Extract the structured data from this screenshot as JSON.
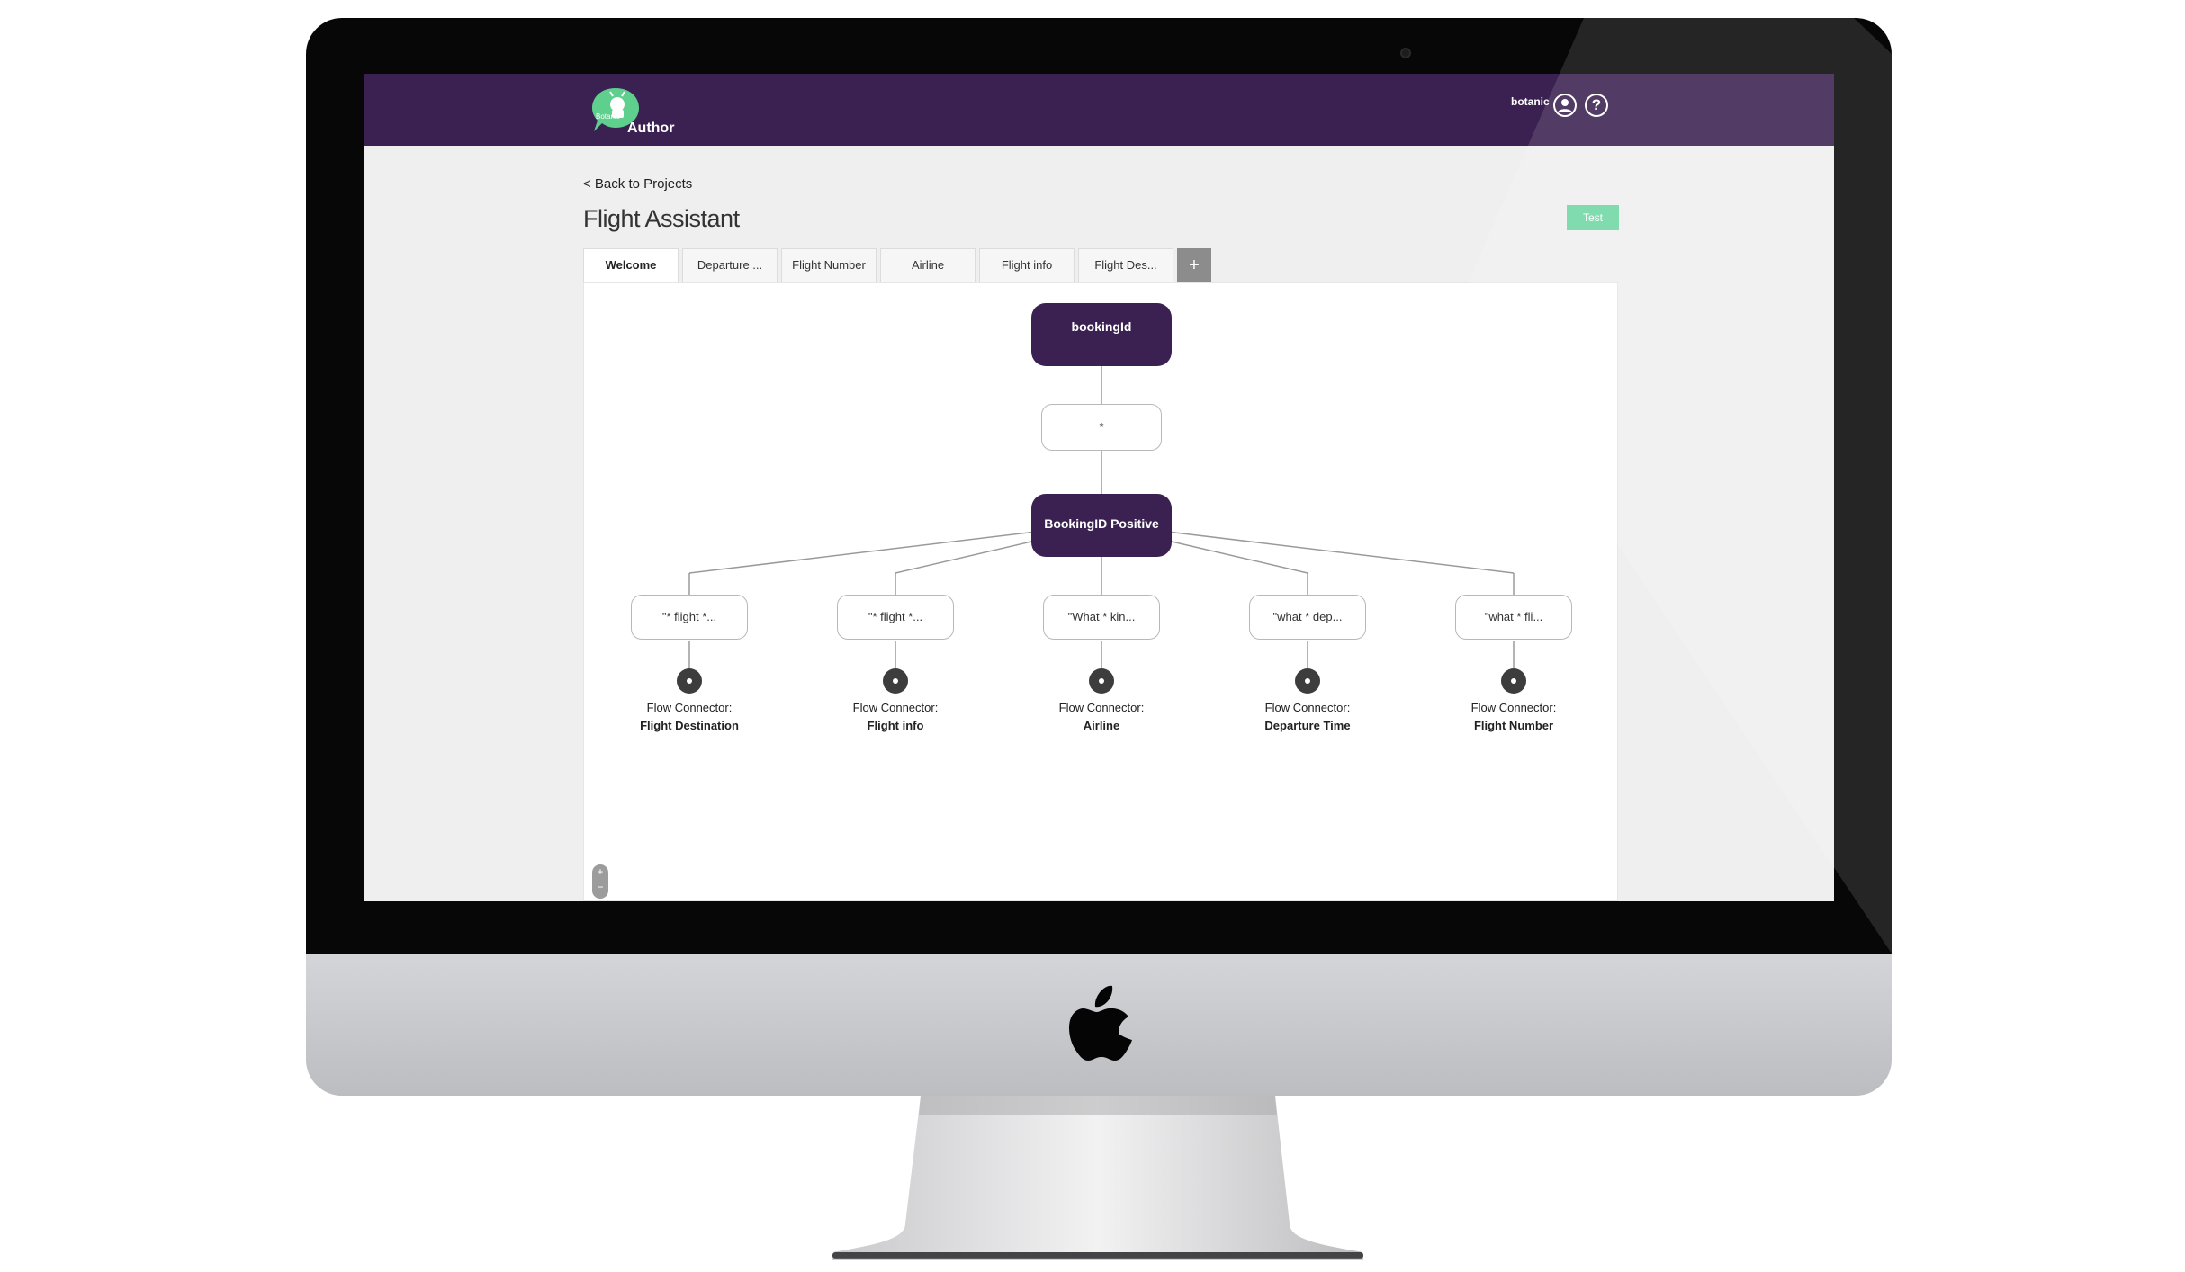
{
  "app": {
    "brand": "Author",
    "logo_text": "Botanic",
    "user_name": "botanic",
    "user_icon": "user-icon",
    "help_icon": "help-icon",
    "help_glyph": "?"
  },
  "page": {
    "back_link": "< Back to Projects",
    "title": "Flight Assistant",
    "test_button": "Test"
  },
  "tabs": [
    {
      "label": "Welcome",
      "active": true
    },
    {
      "label": "Departure ...",
      "active": false
    },
    {
      "label": "Flight Number",
      "active": false
    },
    {
      "label": "Airline",
      "active": false
    },
    {
      "label": "Flight info",
      "active": false
    },
    {
      "label": "Flight Des...",
      "active": false
    }
  ],
  "add_tab_label": "+",
  "flow": {
    "root_node": "bookingId",
    "condition_node": "*",
    "branch_node": "BookingID Positive",
    "options": [
      {
        "pattern": "\"* flight *...",
        "connector_prefix": "Flow Connector:",
        "connector_target": "Flight Destination"
      },
      {
        "pattern": "\"* flight *...",
        "connector_prefix": "Flow Connector:",
        "connector_target": "Flight info"
      },
      {
        "pattern": "\"What * kin...",
        "connector_prefix": "Flow Connector:",
        "connector_target": "Airline"
      },
      {
        "pattern": "\"what * dep...",
        "connector_prefix": "Flow Connector:",
        "connector_target": "Departure Time"
      },
      {
        "pattern": "\"what * fli...",
        "connector_prefix": "Flow Connector:",
        "connector_target": "Flight Number"
      }
    ]
  },
  "zoom": {
    "in_label": "+",
    "out_label": "−"
  },
  "colors": {
    "header": "#3b2151",
    "accent": "#6fd6a4",
    "node_dark": "#3b2151"
  }
}
